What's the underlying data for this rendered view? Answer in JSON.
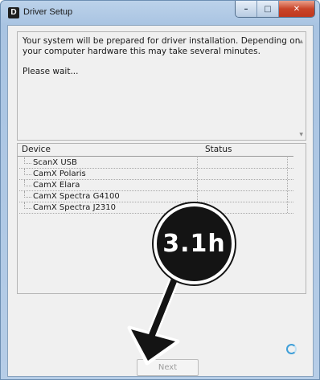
{
  "window": {
    "title": "Driver Setup",
    "app_icon_letter": "D",
    "buttons": {
      "minimize": "–",
      "maximize": "□",
      "close": "✕"
    }
  },
  "message": {
    "lines": [
      "Your system will be prepared for driver installation. Depending on",
      "your computer hardware this may take several minutes."
    ],
    "wait_text": "Please wait..."
  },
  "device_list": {
    "columns": [
      "Device",
      "Status"
    ],
    "rows": [
      {
        "device": "ScanX USB",
        "status": ""
      },
      {
        "device": "CamX Polaris",
        "status": ""
      },
      {
        "device": "CamX Elara",
        "status": ""
      },
      {
        "device": "CamX Spectra G4100",
        "status": ""
      },
      {
        "device": "CamX Spectra J2310",
        "status": ""
      }
    ]
  },
  "footer": {
    "next_label": "Next",
    "spinner_icon": "loading-spinner-icon"
  },
  "annotation": {
    "step_label": "3.1h",
    "arrow_icon": "arrow-down-left-icon"
  },
  "colors": {
    "title_gradient_top": "#bcd2ea",
    "close_button": "#c9452a",
    "spinner": "#3f9fd8",
    "badge": "#141414"
  }
}
